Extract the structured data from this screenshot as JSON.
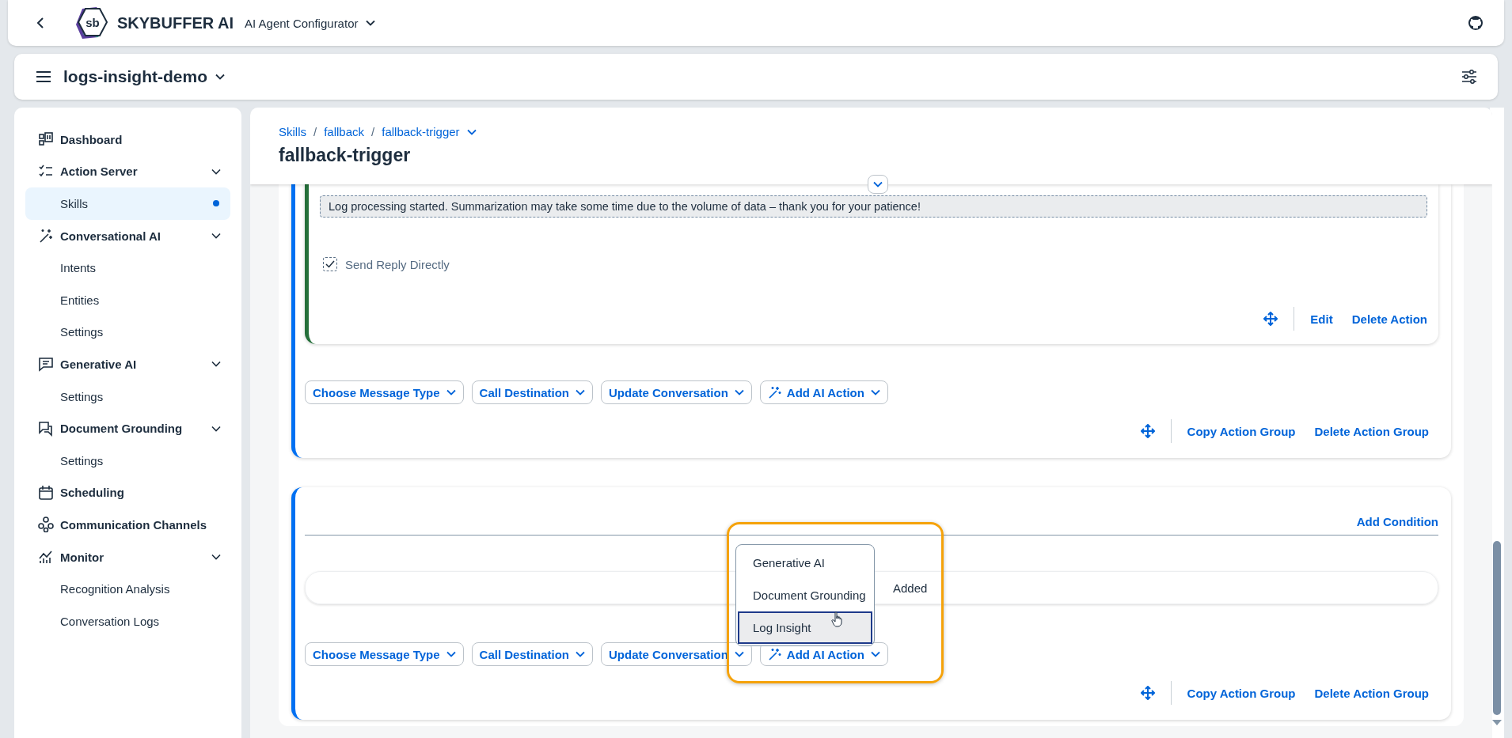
{
  "shell": {
    "logo_text": "sb",
    "brand": "SKYBUFFER AI",
    "app": "AI Agent Configurator"
  },
  "workspace": {
    "title": "logs-insight-demo"
  },
  "sidebar": {
    "items": [
      {
        "label": "Dashboard"
      },
      {
        "label": "Action Server",
        "expanded": true,
        "children": [
          {
            "label": "Skills",
            "selected": true
          }
        ]
      },
      {
        "label": "Conversational AI",
        "expanded": true,
        "children": [
          {
            "label": "Intents",
            "selected": false
          },
          {
            "label": "Entities",
            "selected": false
          },
          {
            "label": "Settings",
            "selected": false
          }
        ]
      },
      {
        "label": "Generative AI",
        "expanded": true,
        "children": [
          {
            "label": "Settings",
            "selected": false
          }
        ]
      },
      {
        "label": "Document Grounding",
        "expanded": true,
        "children": [
          {
            "label": "Settings",
            "selected": false
          }
        ]
      },
      {
        "label": "Scheduling"
      },
      {
        "label": "Communication Channels"
      },
      {
        "label": "Monitor",
        "expanded": true,
        "children": [
          {
            "label": "Recognition Analysis",
            "selected": false
          },
          {
            "label": "Conversation Logs",
            "selected": false
          }
        ]
      }
    ]
  },
  "breadcrumb": [
    "Skills",
    "fallback",
    "fallback-trigger"
  ],
  "breadcrumb_separator": "/",
  "page_title": "fallback-trigger",
  "action_groups": [
    {
      "action": {
        "message": "Log processing started. Summarization may take some time due to the volume of data – thank you for your patience!",
        "send_reply_directly": {
          "label": "Send Reply Directly",
          "checked": true
        },
        "links": [
          "Edit",
          "Delete Action"
        ]
      },
      "add_buttons": [
        "Choose Message Type",
        "Call Destination",
        "Update Conversation",
        "Add AI Action"
      ],
      "footer_links": [
        "Copy Action Group",
        "Delete Action Group"
      ]
    },
    {
      "add_condition": "Add Condition",
      "empty_text": "Added",
      "add_buttons": [
        "Choose Message Type",
        "Call Destination",
        "Update Conversation",
        "Add AI Action"
      ],
      "footer_links": [
        "Copy Action Group",
        "Delete Action Group"
      ],
      "menu": [
        {
          "label": "Generative AI",
          "selected": false
        },
        {
          "label": "Document Grounding",
          "selected": false
        },
        {
          "label": "Log Insight",
          "selected": true
        }
      ]
    }
  ]
}
